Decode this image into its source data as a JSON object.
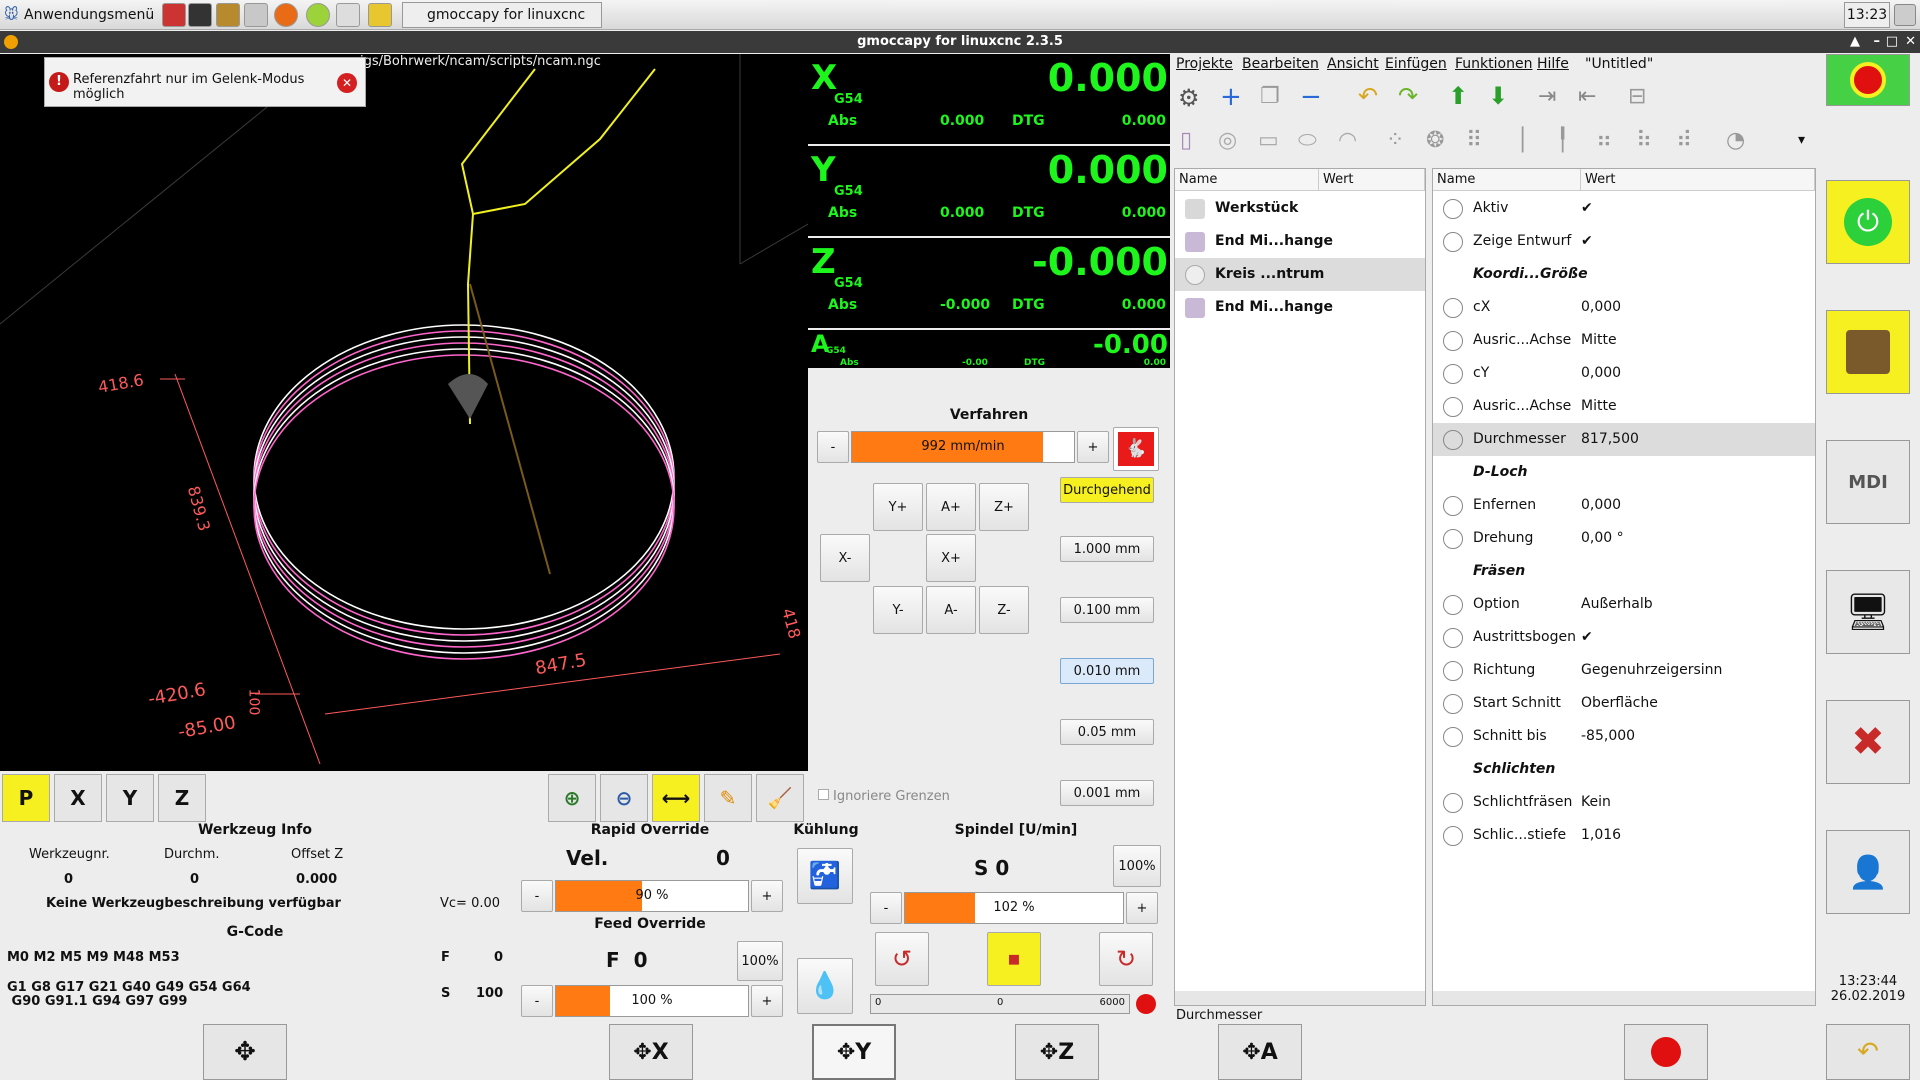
{
  "taskbar": {
    "menu_label": "Anwendungsmenü",
    "task_label": "gmoccapy for linuxcnc ...",
    "clock": "13:23"
  },
  "window": {
    "title": "gmoccapy for linuxcnc  2.3.5"
  },
  "preview": {
    "file_path": "igs/Bohrwerk/ncam/scripts/ncam.ngc",
    "notice": "Referenzfahrt nur im Gelenk-Modus möglich",
    "dims": {
      "d1": "418.6",
      "d2": "839.3",
      "d3": "847.5",
      "d4": "-420.6",
      "d5": "-85.00",
      "d6": "418",
      "d7": "100"
    },
    "view_buttons": [
      "P",
      "X",
      "Y",
      "Z"
    ]
  },
  "dro": {
    "axes": [
      {
        "axis": "X",
        "g": "G54",
        "value": "0.000",
        "abs_label": "Abs",
        "abs": "0.000",
        "dtg_label": "DTG",
        "dtg": "0.000"
      },
      {
        "axis": "Y",
        "g": "G54",
        "value": "0.000",
        "abs_label": "Abs",
        "abs": "0.000",
        "dtg_label": "DTG",
        "dtg": "0.000"
      },
      {
        "axis": "Z",
        "g": "G54",
        "value": "-0.000",
        "abs_label": "Abs",
        "abs": "-0.000",
        "dtg_label": "DTG",
        "dtg": "0.000"
      },
      {
        "axis": "A",
        "g": "G54",
        "value": "-0.00",
        "abs_label": "Abs",
        "abs": "-0.00",
        "dtg_label": "DTG",
        "dtg": "0.00"
      }
    ]
  },
  "jog": {
    "title": "Verfahren",
    "minus": "-",
    "plus": "+",
    "speed_label": "992 mm/min",
    "speed_fraction": 0.86,
    "mode": "Durchgehend",
    "buttons": {
      "yplus": "Y+",
      "aplus": "A+",
      "zplus": "Z+",
      "xminus": "X-",
      "xplus": "X+",
      "yminus": "Y-",
      "aminus": "A-",
      "zminus": "Z-"
    },
    "increments": [
      "1.000 mm",
      "0.100 mm",
      "0.010 mm",
      "0.05 mm",
      "0.001 mm"
    ],
    "ignore_limits": "Ignoriere Grenzen"
  },
  "tool_info": {
    "title": "Werkzeug Info",
    "headers": [
      "Werkzeugnr.",
      "Durchm.",
      "Offset Z"
    ],
    "values": [
      "0",
      "0",
      "0.000"
    ],
    "description": "Keine Werkzeugbeschreibung verfügbar",
    "vc": "Vc= 0.00"
  },
  "gcode": {
    "title": "G-Code",
    "line1": "M0 M2 M5 M9 M48 M53",
    "f_label": "F",
    "f_val": "0",
    "line2": "G1 G8 G17 G21 G40 G49 G54 G64",
    "line3": " G90 G91.1 G94 G97 G99",
    "s_label": "S",
    "s_val": "100"
  },
  "rapid": {
    "title": "Rapid Override",
    "vel_label": "Vel.",
    "vel_val": "0",
    "bar": "90 %",
    "fraction": 0.45
  },
  "feed": {
    "title": "Feed Override",
    "f_label": "F  0",
    "pct_btn": "100%",
    "bar": "100 %",
    "fraction": 0.28
  },
  "cooling": {
    "title": "Kühlung"
  },
  "spindle": {
    "title": "Spindel [U/min]",
    "s_label": "S 0",
    "pct_btn": "100%",
    "bar": "102 %",
    "fraction": 0.32,
    "scale_min": "0",
    "scale_mid": "0",
    "scale_max": "6000"
  },
  "ncam": {
    "menus": [
      "Projekte",
      "Bearbeiten",
      "Ansicht",
      "Einfügen",
      "Funktionen",
      "Hilfe"
    ],
    "untitled": "\"Untitled\"",
    "tree_headers": [
      "Name",
      "Wert"
    ],
    "tree": [
      "Werkstück",
      "End Mi...hange",
      "Kreis ...ntrum",
      "End Mi...hange"
    ],
    "prop_headers": [
      "Name",
      "Wert"
    ],
    "props": [
      {
        "name": "Aktiv",
        "value": "✔"
      },
      {
        "name": "Zeige Entwurf",
        "value": "✔"
      },
      {
        "name": "Koordi...Größe",
        "value": "",
        "section": true
      },
      {
        "name": "cX",
        "value": "0,000"
      },
      {
        "name": "Ausric...Achse",
        "value": "Mitte"
      },
      {
        "name": "cY",
        "value": "0,000"
      },
      {
        "name": "Ausric...Achse",
        "value": "Mitte"
      },
      {
        "name": "Durchmesser",
        "value": "817,500",
        "selected": true
      },
      {
        "name": "D-Loch",
        "value": "",
        "section": true
      },
      {
        "name": "Enfernen",
        "value": "0,000"
      },
      {
        "name": "Drehung",
        "value": "0,00 °"
      },
      {
        "name": "Fräsen",
        "value": "",
        "section": true
      },
      {
        "name": "Option",
        "value": "Außerhalb"
      },
      {
        "name": "Austrittsbogen",
        "value": "✔"
      },
      {
        "name": "Richtung",
        "value": "Gegenuhrzeigersinn"
      },
      {
        "name": "Start Schnitt",
        "value": "Oberfläche"
      },
      {
        "name": "Schnitt bis",
        "value": "-85,000"
      },
      {
        "name": "Schlichten",
        "value": "",
        "section": true
      },
      {
        "name": "Schlichtfräsen",
        "value": "Kein"
      },
      {
        "name": "Schlic...stiefe",
        "value": "1,016"
      }
    ],
    "status": "Durchmesser"
  },
  "right": {
    "mdi_label": "MDI",
    "time": "13:23:44",
    "date": "26.02.2019"
  },
  "colors": {
    "dro_green": "#1df51d",
    "orange": "#ff7a13",
    "yellow": "#f6f020",
    "estop_red": "#e01010",
    "toolpath": "#f0f020",
    "circle": "#ff66cc",
    "dim": "#ff5a5a"
  }
}
